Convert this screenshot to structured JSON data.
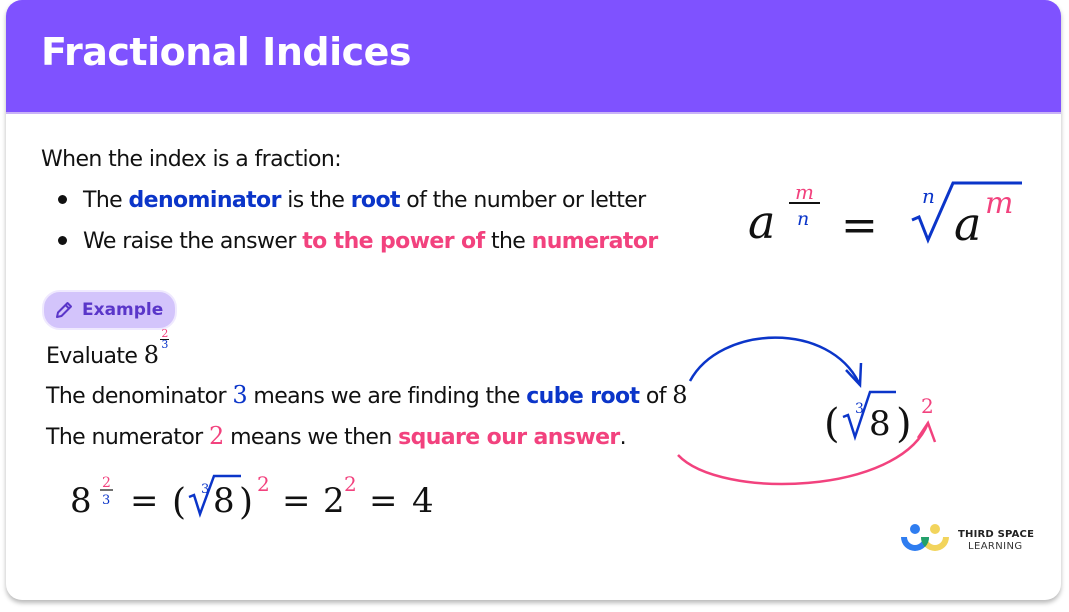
{
  "header": {
    "title": "Fractional Indices"
  },
  "colors": {
    "header_bg": "#7f52ff",
    "blue": "#0b35c9",
    "pink": "#f2427e",
    "pill_bg": "#d3c4fb",
    "pill_text": "#5a36c9"
  },
  "intro": {
    "lead": "When the index is a fraction:",
    "bullets": [
      {
        "parts": [
          "The ",
          "denominator",
          " is the ",
          "root",
          " of the number or letter"
        ]
      },
      {
        "parts": [
          "We raise the answer ",
          "to the power of",
          " the ",
          "numerator"
        ]
      }
    ]
  },
  "rule": {
    "base": "a",
    "exp_num": "m",
    "exp_den": "n",
    "equals": "=",
    "root_index": "n",
    "radicand": "a",
    "radicand_exp": "m"
  },
  "example": {
    "pill_icon": "pencil-icon",
    "pill_label": "Example",
    "evaluate_label": "Evaluate ",
    "evaluate_base": "8",
    "evaluate_num": "2",
    "evaluate_den": "3",
    "line1": [
      "The denominator ",
      "3",
      " means we are finding the ",
      "cube root",
      " of ",
      "8"
    ],
    "line2": [
      "The numerator ",
      "2",
      " means we then ",
      "square our answer",
      "."
    ],
    "diagram": {
      "open": "(",
      "root_index": "3",
      "radicand": "8",
      "close": ")",
      "exponent": "2"
    },
    "solution": {
      "base": "8",
      "num": "2",
      "den": "3",
      "eq1": "=",
      "open": "(",
      "root_index": "3",
      "radicand": "8",
      "close": ")",
      "exp1": "2",
      "eq2": "=",
      "base2": "2",
      "exp2": "2",
      "eq3": "=",
      "result": "4"
    }
  },
  "logo": {
    "line1": "THIRD SPACE",
    "line2": "LEARNING"
  }
}
